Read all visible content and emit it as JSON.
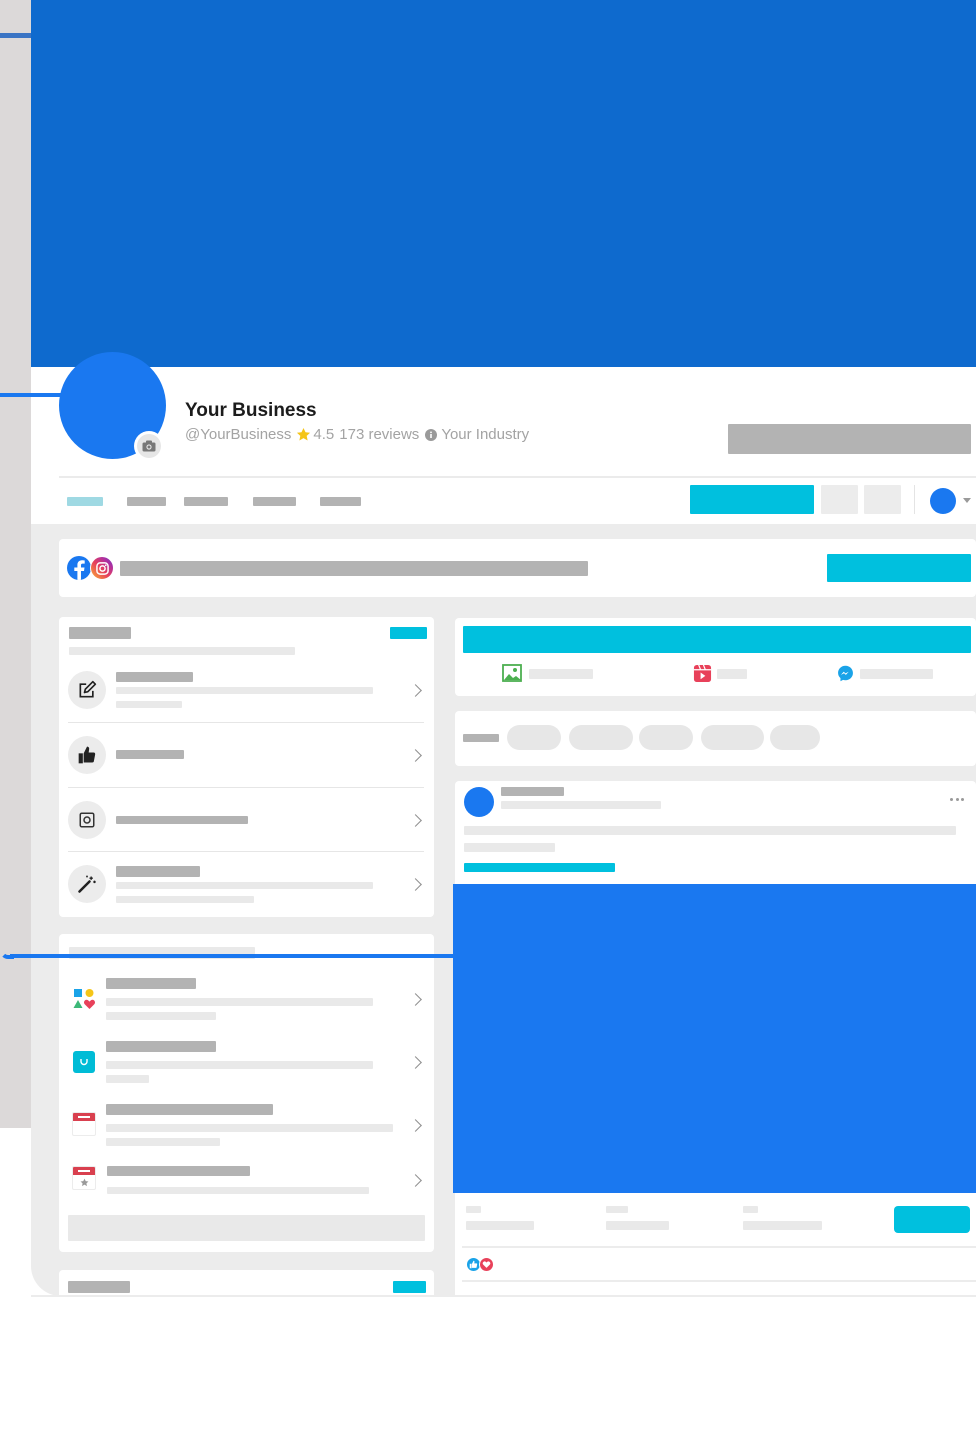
{
  "profile": {
    "name": "Your Business",
    "handle": "@YourBusiness",
    "rating": "4.5",
    "reviews": "173 reviews",
    "industry": "Your Industry"
  },
  "colors": {
    "cover": "#0e6ace",
    "accent_blue": "#1a78f0",
    "cyan": "#00c0de",
    "placeholder": "#b3b3b3",
    "star": "#f5c518"
  },
  "icons": [
    "camera-icon",
    "facebook-icon",
    "instagram-icon",
    "edit-icon",
    "thumbs-up-icon",
    "instagram-outline-icon",
    "magic-wand-icon",
    "shapes-icon",
    "shopping-bag-icon",
    "calendar-icon",
    "calendar-star-icon",
    "photo-icon",
    "reel-icon",
    "messenger-icon",
    "more-icon",
    "chevron-right-icon",
    "dropdown-caret-icon",
    "like-reaction-icon",
    "love-reaction-icon"
  ]
}
